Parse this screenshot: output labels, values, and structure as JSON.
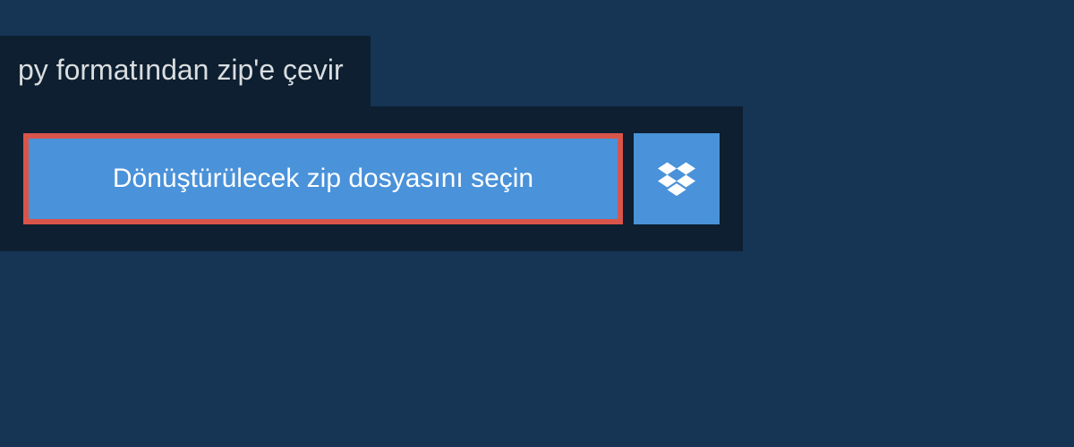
{
  "header": {
    "title": "py formatından zip'e çevir"
  },
  "upload": {
    "select_file_label": "Dönüştürülecek zip dosyasını seçin",
    "dropbox_icon": "dropbox-icon"
  },
  "colors": {
    "background": "#163453",
    "panel": "#0d1f30",
    "button": "#4a92d9",
    "highlight_border": "#d9554a"
  }
}
